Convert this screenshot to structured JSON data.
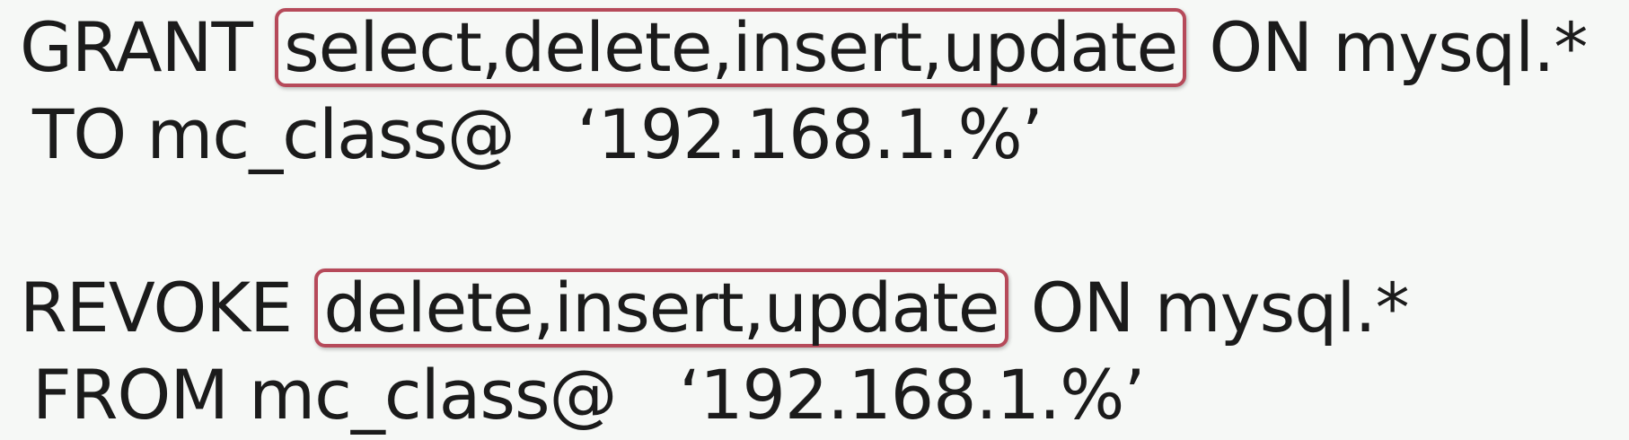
{
  "grant": {
    "keyword": "GRANT",
    "privileges": "select,delete,insert,update",
    "on_clause": "ON mysql.*",
    "to_clause": "TO mc_class@   ‘192.168.1.%’"
  },
  "revoke": {
    "keyword": "REVOKE",
    "privileges": "delete,insert,update",
    "on_clause": "ON mysql.*",
    "from_clause": "FROM mc_class@   ‘192.168.1.%’"
  },
  "colors": {
    "background": "#f6f8f6",
    "text": "#1b1b1b",
    "highlight_border": "#b64a5a"
  }
}
